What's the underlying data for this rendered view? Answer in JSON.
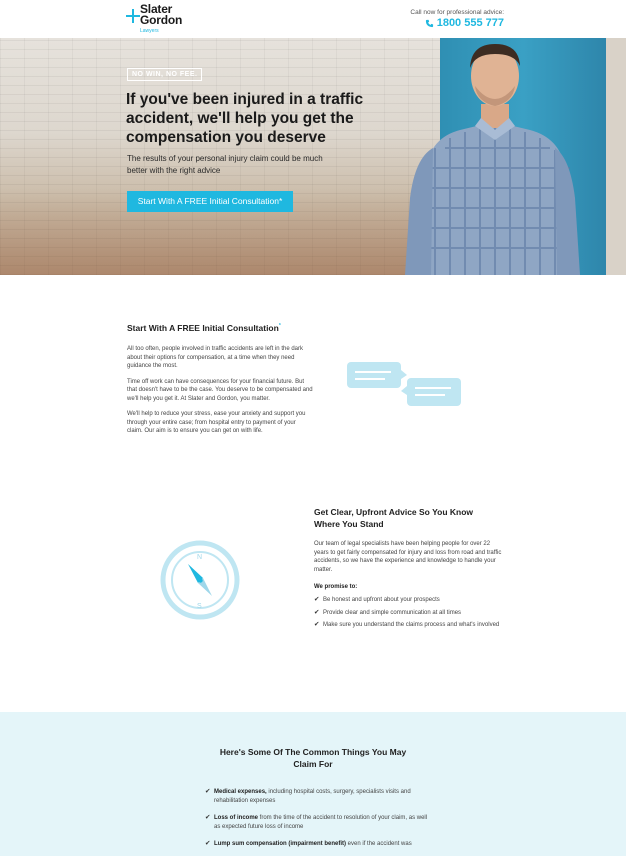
{
  "header": {
    "logo_line1": "Slater",
    "logo_line2": "Gordon",
    "logo_sub": "Lawyers",
    "call_label": "Call now for professional advice:",
    "phone": "1800 555 777"
  },
  "hero": {
    "badge": "NO WIN, NO FEE.",
    "headline": "If you've been injured in a traffic accident, we'll help you get the compensation you deserve",
    "subhead": "The results of your personal injury claim could be much better with the right advice",
    "cta_label": "Start With A FREE Initial Consultation*"
  },
  "section1": {
    "title": "Start With A FREE Initial Consultation",
    "title_mark": "*",
    "paragraphs": [
      "All too often, people involved in traffic accidents are left in the dark about their options for compensation, at a time when they need guidance the most.",
      "Time off work can have consequences for your financial future. But that doesn't have to be the case. You deserve to be compensated and we'll help you get it. At Slater and Gordon, you matter.",
      "We'll help to reduce your stress, ease your anxiety and support you through your entire case; from hospital entry to payment of your claim. Our aim is to ensure you can get on with life."
    ]
  },
  "section2": {
    "title": "Get Clear, Upfront Advice So You Know Where You Stand",
    "body": "Our team of legal specialists have been helping people for over 22 years to get fairly compensated for injury and loss from road and traffic accidents, so we have the experience and knowledge to handle your matter.",
    "promise_label": "We promise to:",
    "promises": [
      "Be honest and upfront about your prospects",
      "Provide clear and simple communication at all times",
      "Make sure you understand the claims process and what's involved"
    ]
  },
  "section3": {
    "title": "Here's Some Of The Common Things You May Claim For",
    "items": [
      {
        "bold": "Medical expenses,",
        "text": " including hospital costs, surgery, specialists visits and rehabilitation expenses"
      },
      {
        "bold": "Loss of income",
        "text": " from the time of the accident to resolution of your claim, as well as expected future loss of income"
      },
      {
        "bold": "Lump sum compensation (impairment benefit)",
        "text": " even if the accident was"
      }
    ]
  },
  "colors": {
    "accent": "#1fb8e0",
    "light_panel": "#e4f5f9",
    "chat_bubble": "#bfe6f2"
  },
  "icons": [
    "phone-icon",
    "compass-icon",
    "chat-bubbles-icon",
    "check-icon"
  ]
}
